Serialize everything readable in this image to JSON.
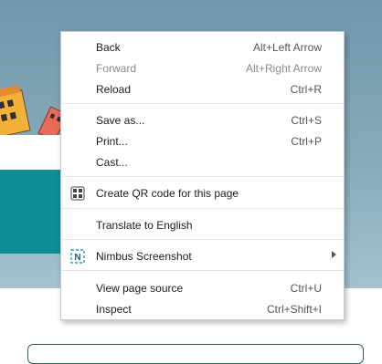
{
  "menu": {
    "back": {
      "label": "Back",
      "shortcut": "Alt+Left Arrow"
    },
    "forward": {
      "label": "Forward",
      "shortcut": "Alt+Right Arrow"
    },
    "reload": {
      "label": "Reload",
      "shortcut": "Ctrl+R"
    },
    "save_as": {
      "label": "Save as...",
      "shortcut": "Ctrl+S"
    },
    "print": {
      "label": "Print...",
      "shortcut": "Ctrl+P"
    },
    "cast": {
      "label": "Cast..."
    },
    "qr": {
      "label": "Create QR code for this page",
      "icon": "qr-code-icon"
    },
    "translate": {
      "label": "Translate to English"
    },
    "nimbus": {
      "label": "Nimbus Screenshot",
      "icon": "nimbus-extension-icon"
    },
    "view_source": {
      "label": "View page source",
      "shortcut": "Ctrl+U"
    },
    "inspect": {
      "label": "Inspect",
      "shortcut": "Ctrl+Shift+I"
    }
  },
  "colors": {
    "hero_bg": "#7fa3b4",
    "teal_panel": "#0f8c96",
    "disabled_text": "#8a8a8a",
    "nimbus_accent": "#1ea8a6"
  }
}
